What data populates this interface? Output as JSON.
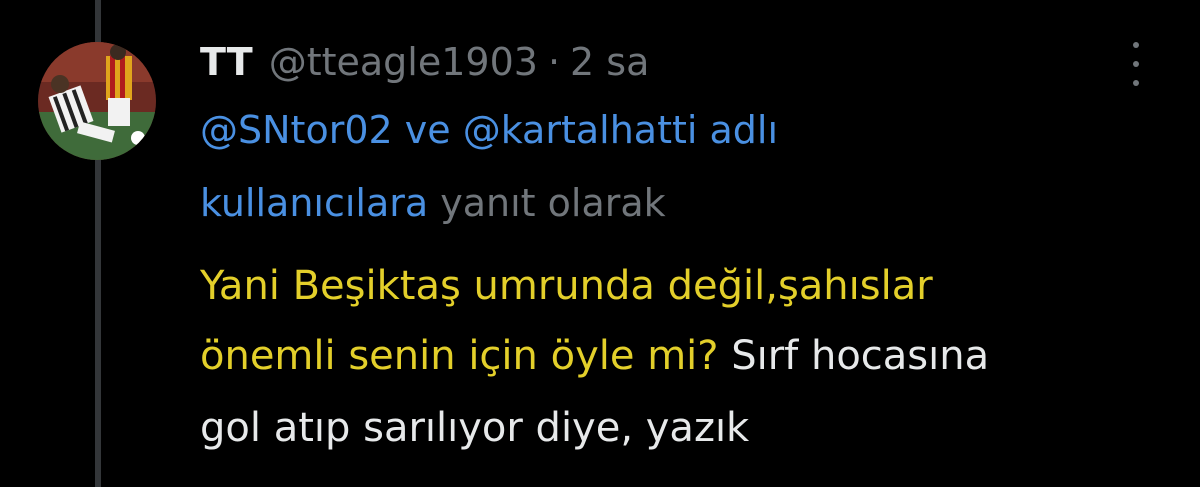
{
  "tweet": {
    "display_name": "TT",
    "handle": "@tteagle1903",
    "separator": "·",
    "time": "2 sa",
    "avatar_icon": "football-player-avatar",
    "more_icon": "vertical-ellipsis-icon",
    "reply_context": {
      "mention_1": "@SNtor02",
      "conjunction": " ve ",
      "mention_2": "@kartalhatti adlı",
      "mention_3": "kullanıcılara",
      "suffix": " yanıt olarak"
    },
    "body": {
      "line1_highlight": "Yani Beşiktaş umrunda değil,şahıslar",
      "line2_highlight": "önemli senin için öyle mi?",
      "line2_plain": " Sırf hocasına",
      "line3_plain": "gol atıp sarılıyor diye, yazık"
    }
  },
  "colors": {
    "background": "#000000",
    "text": "#e7e9ea",
    "secondary": "#71767b",
    "link": "#4a90e2",
    "highlight": "#e3cf2a",
    "thread_line": "#333639"
  }
}
